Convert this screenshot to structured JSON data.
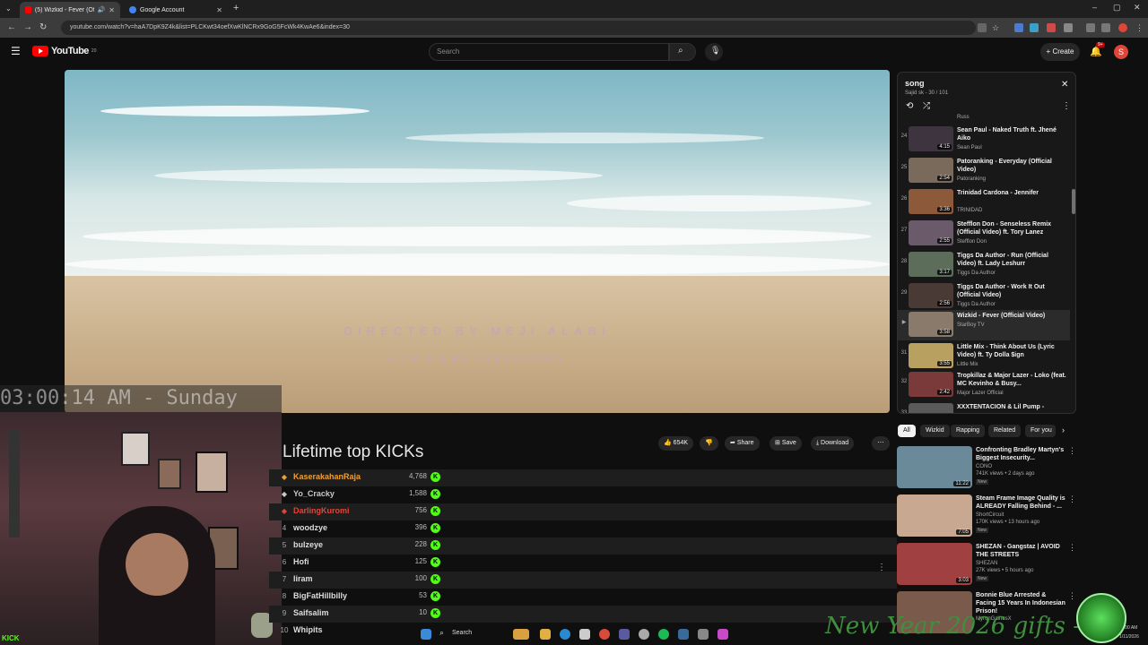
{
  "browser": {
    "tabs": [
      {
        "title": "(5) Wizkid - Fever (Official V",
        "active": true
      },
      {
        "title": "Google Account",
        "active": false
      }
    ],
    "url": "youtube.com/watch?v=haA7DpK9Z4k&list=PLCKwt34oefXwKlNCRx9GoG5FcWk4KwAe6&index=30"
  },
  "youtube": {
    "logo_text": "YouTube",
    "logo_sup": "20",
    "search_placeholder": "Search",
    "create_label": "Create",
    "notif_count": "9+",
    "avatar_letter": "S"
  },
  "video": {
    "credit_line1": "DIRECTED BY MEJI ALABI",
    "credit_line2": "A JM FILMS PRODUCTION"
  },
  "playlist": {
    "title": "song",
    "subtitle": "Sajid sk - 30 / 101",
    "top_channel": "Russ",
    "items": [
      {
        "idx": "24",
        "title": "Sean Paul - Naked Truth ft. Jhené Aiko",
        "channel": "Sean Paul",
        "duration": "4:15"
      },
      {
        "idx": "25",
        "title": "Patoranking - Everyday (Official Video)",
        "channel": "Patoranking",
        "duration": "2:54"
      },
      {
        "idx": "26",
        "title": "Trinidad Cardona - Jennifer",
        "channel": "TRINIDAD",
        "duration": "3:36"
      },
      {
        "idx": "27",
        "title": "Stefflon Don - Senseless Remix (Official Video) ft. Tory Lanez",
        "channel": "Stefflon Don",
        "duration": "2:55"
      },
      {
        "idx": "28",
        "title": "Tiggs Da Author - Run (Official Video) ft. Lady Leshurr",
        "channel": "Tiggs Da Author",
        "duration": "3:17"
      },
      {
        "idx": "29",
        "title": "Tiggs Da Author - Work It Out (Official Video)",
        "channel": "Tiggs Da Author",
        "duration": "2:56"
      },
      {
        "idx": "▶",
        "title": "Wizkid - Fever (Official Video)",
        "channel": "StarBoy TV",
        "duration": "3:58"
      },
      {
        "idx": "31",
        "title": "Little Mix - Think About Us (Lyric Video) ft. Ty Dolla $ign",
        "channel": "Little Mix",
        "duration": "3:55"
      },
      {
        "idx": "32",
        "title": "Tropkillaz & Major Lazer - Loko (feat. MC Kevinho & Busy...",
        "channel": "Major Lazer Official",
        "duration": "2:42"
      },
      {
        "idx": "33",
        "title": "XXXTENTACION & Lil Pump -",
        "channel": "",
        "duration": ""
      }
    ]
  },
  "chips": [
    "All",
    "Wizkid",
    "Rapping",
    "Related",
    "For you"
  ],
  "actions": {
    "likes": "654K",
    "share": "Share",
    "save": "Save",
    "download": "Download"
  },
  "recommendations": [
    {
      "title": "Confronting Bradley Martyn's Biggest Insecurity...",
      "channel": "CONO",
      "meta": "741K views • 2 days ago",
      "badge": "New",
      "duration": "11:22"
    },
    {
      "title": "Steam Frame Image Quality is ALREADY Falling Behind - ...",
      "channel": "ShortCircuit",
      "meta": "170K views • 13 hours ago",
      "badge": "New",
      "duration": "7:05"
    },
    {
      "title": "SHEZAN - Gangstaz | AVOID THE STREETS",
      "channel": "SHEZAN",
      "meta": "27K views • 5 hours ago",
      "badge": "New",
      "duration": "3:03"
    },
    {
      "title": "Bonnie Blue Arrested & Facing 15 Years In Indonesian Prison!",
      "channel": "MyronGainesX",
      "meta": "",
      "badge": "",
      "duration": ""
    }
  ],
  "kicks": {
    "title": "Lifetime top KICKs",
    "rows": [
      {
        "rank": "",
        "name": "KaserakahanRaja",
        "count": "4,768",
        "color": "#f0a030"
      },
      {
        "rank": "",
        "name": "Yo_Cracky",
        "count": "1,588",
        "color": "#c8c8c8"
      },
      {
        "rank": "",
        "name": "DarlingKuromi",
        "count": "756",
        "color": "#e0453a"
      },
      {
        "rank": "4",
        "name": "woodzye",
        "count": "396",
        "color": "#dddddd"
      },
      {
        "rank": "5",
        "name": "bulzeye",
        "count": "228",
        "color": "#dddddd"
      },
      {
        "rank": "6",
        "name": "Hofi",
        "count": "125",
        "color": "#dddddd"
      },
      {
        "rank": "7",
        "name": "liram",
        "count": "100",
        "color": "#dddddd"
      },
      {
        "rank": "8",
        "name": "BigFatHillbilly",
        "count": "53",
        "color": "#dddddd"
      },
      {
        "rank": "9",
        "name": "Saifsalim",
        "count": "10",
        "color": "#dddddd"
      },
      {
        "rank": "10",
        "name": "Whipits",
        "count": "",
        "color": "#dddddd"
      }
    ]
  },
  "overlay": {
    "clock": "03:00:14 AM - Sunday",
    "kick_badge": "KICK",
    "gifts_text": "New Year 2026 gifts -"
  },
  "taskbar": {
    "search_label": "Search",
    "time": "3:00 AM",
    "date": "1/11/2026"
  }
}
